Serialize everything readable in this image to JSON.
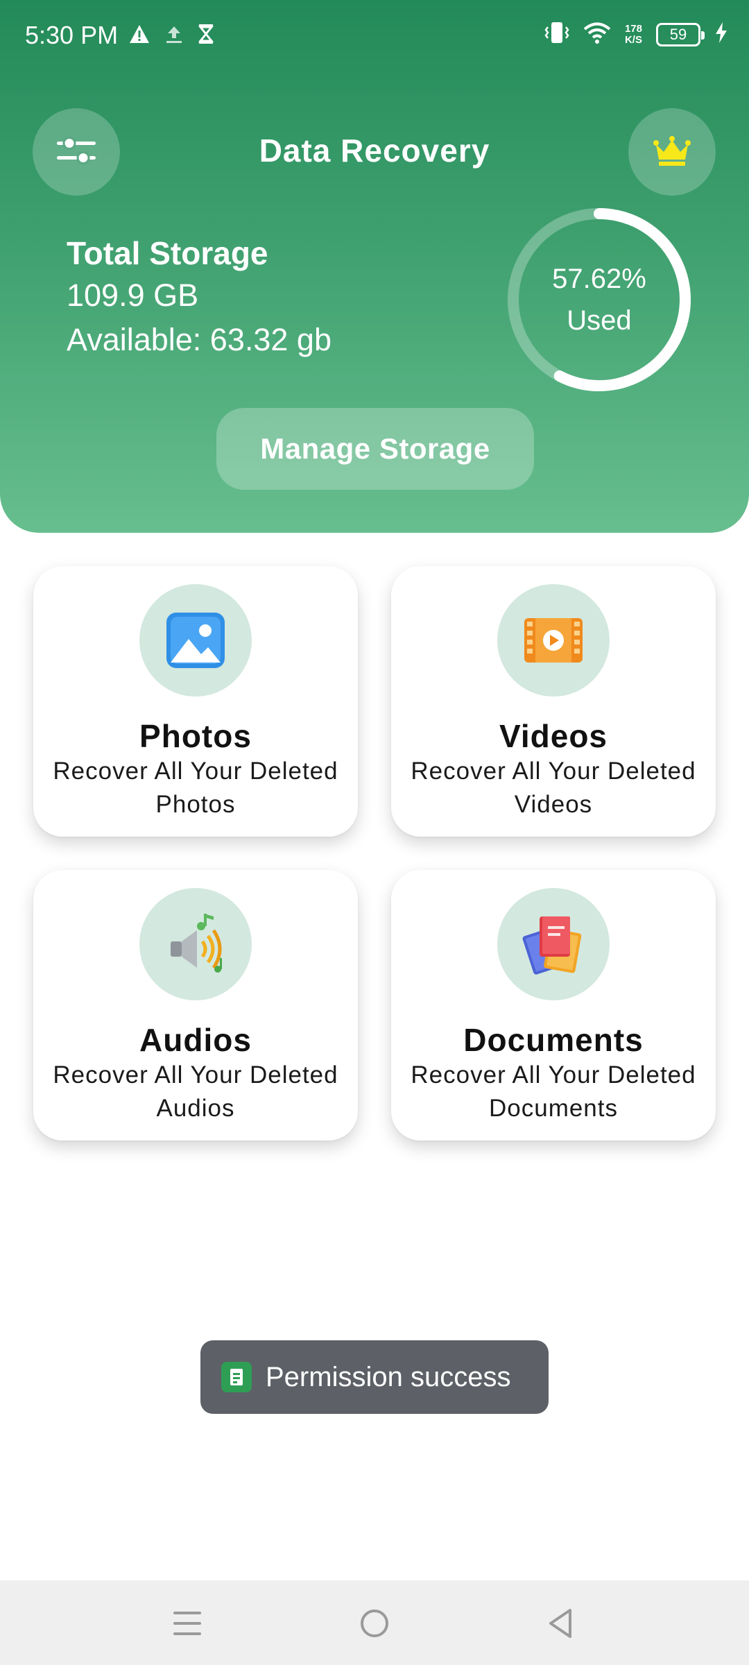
{
  "status_bar": {
    "time": "5:30 PM",
    "net_speed_value": "178",
    "net_speed_unit": "K/S",
    "battery": "59",
    "icons": [
      "warning-icon",
      "upload-icon",
      "hourglass-icon",
      "vibrate-icon",
      "wifi-icon",
      "battery-icon",
      "charging-icon"
    ]
  },
  "header": {
    "title": "Data Recovery",
    "settings_icon": "sliders-icon",
    "premium_icon": "crown-icon"
  },
  "storage": {
    "title": "Total Storage",
    "total": "109.9 GB",
    "available": "Available: 63.32 gb",
    "used_percent_label": "57.62%",
    "used_label": "Used",
    "used_fraction": 0.5762,
    "manage_button": "Manage Storage"
  },
  "cards": [
    {
      "title": "Photos",
      "line1": "Recover All Your Deleted",
      "line2": "Photos",
      "icon": "photo-icon"
    },
    {
      "title": "Videos",
      "line1": "Recover All Your Deleted",
      "line2": "Videos",
      "icon": "video-icon"
    },
    {
      "title": "Audios",
      "line1": "Recover All Your Deleted",
      "line2": "Audios",
      "icon": "audio-icon"
    },
    {
      "title": "Documents",
      "line1": "Recover All Your Deleted",
      "line2": "Documents",
      "icon": "documents-icon"
    }
  ],
  "toast": {
    "text": "Permission success"
  },
  "colors": {
    "header_top": "#228a58",
    "header_bottom": "#67be8e",
    "crown": "#f7e81a",
    "icon_bg": "#d3e8df",
    "toast_bg": "#5d6066",
    "nav_bg": "#efefef"
  },
  "nav": [
    "menu-icon",
    "home-icon",
    "back-icon"
  ]
}
